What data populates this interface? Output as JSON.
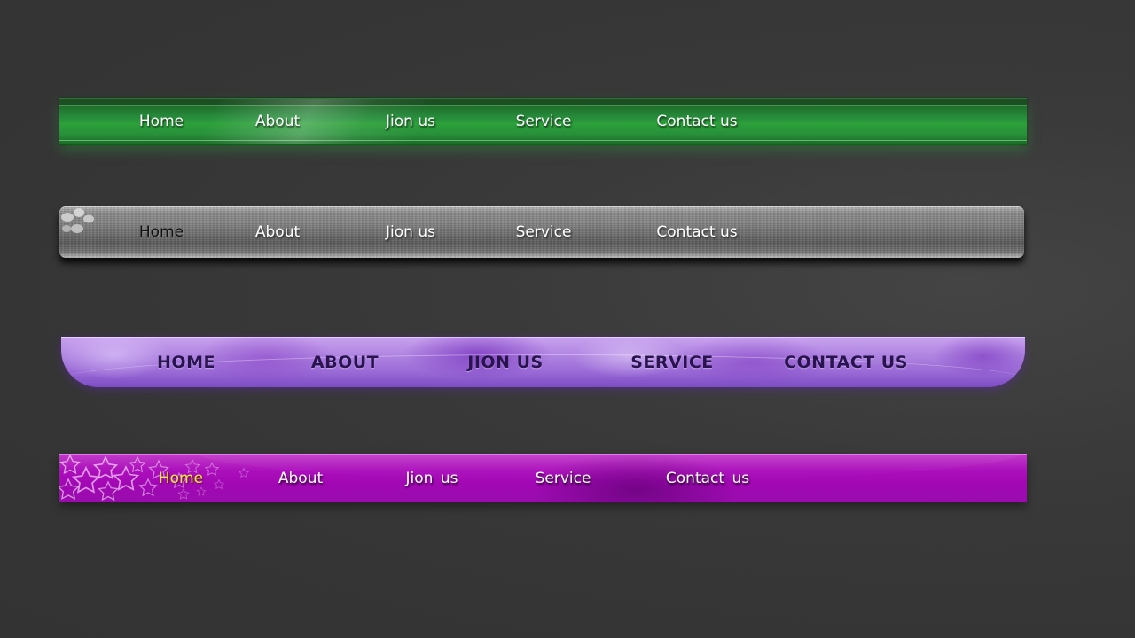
{
  "menus": {
    "green": {
      "items": [
        {
          "label": "Home"
        },
        {
          "label": "About"
        },
        {
          "label": "Jion us"
        },
        {
          "label": "Service"
        },
        {
          "label": "Contact us"
        }
      ],
      "colors": {
        "bar": "#2ca03a",
        "text": "#ffffff"
      }
    },
    "silver": {
      "items": [
        {
          "label": "Home",
          "active": true
        },
        {
          "label": "About"
        },
        {
          "label": "Jion us"
        },
        {
          "label": "Service"
        },
        {
          "label": "Contact us"
        }
      ],
      "icon": "paw-print-icon",
      "colors": {
        "bar": "#808080",
        "text": "#ffffff",
        "active_text": "#111111"
      }
    },
    "purple": {
      "items": [
        {
          "label": "HOME"
        },
        {
          "label": "ABOUT"
        },
        {
          "label": "JION US"
        },
        {
          "label": "SERVICE"
        },
        {
          "label": "CONTACT US"
        }
      ],
      "colors": {
        "bar": "#ad82e0",
        "text": "#2a1450"
      }
    },
    "magenta": {
      "items": [
        {
          "label": "Home",
          "active": true
        },
        {
          "label": "About"
        },
        {
          "label": "Jion  us"
        },
        {
          "label": "Service"
        },
        {
          "label": "Contact  us"
        }
      ],
      "icon": "stars-decoration-icon",
      "colors": {
        "bar": "#a208b4",
        "text": "#ffffff",
        "active_text": "#f2ee2e"
      }
    }
  }
}
